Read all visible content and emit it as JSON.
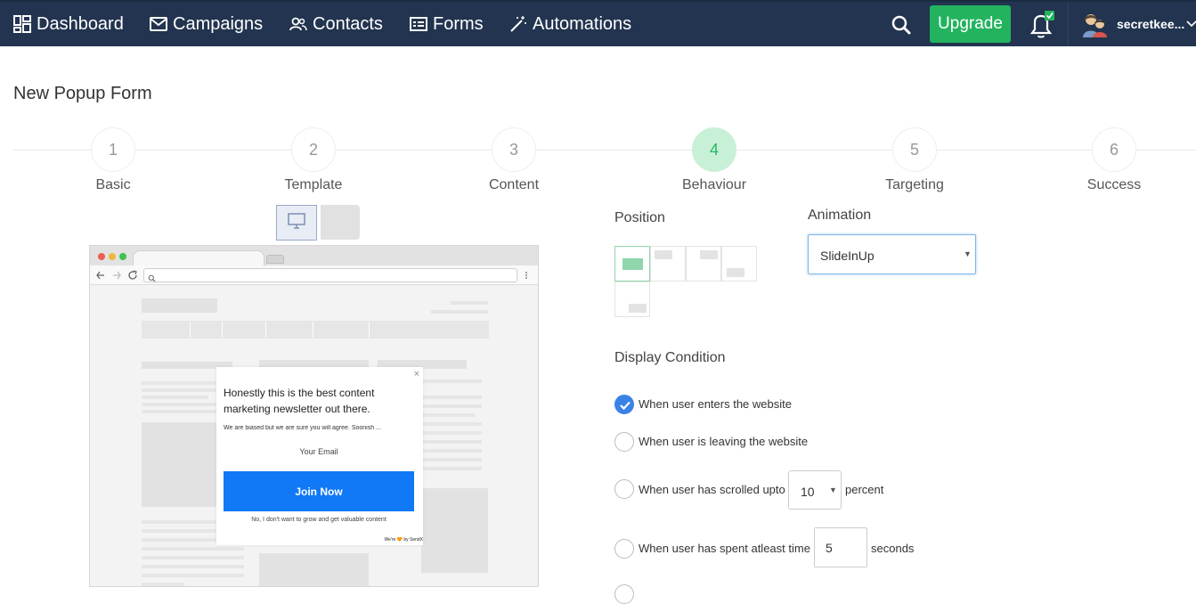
{
  "nav": {
    "items": [
      {
        "label": "Dashboard",
        "icon": "dashboard-icon"
      },
      {
        "label": "Campaigns",
        "icon": "envelope-icon"
      },
      {
        "label": "Contacts",
        "icon": "contacts-icon"
      },
      {
        "label": "Forms",
        "icon": "forms-icon"
      },
      {
        "label": "Automations",
        "icon": "magic-wand-icon"
      }
    ],
    "upgrade_label": "Upgrade",
    "username": "secretkee...",
    "bg_color": "#22344f",
    "upgrade_color": "#23b35f"
  },
  "page": {
    "title": "New Popup Form"
  },
  "steps": [
    {
      "number": "1",
      "label": "Basic"
    },
    {
      "number": "2",
      "label": "Template"
    },
    {
      "number": "3",
      "label": "Content"
    },
    {
      "number": "4",
      "label": "Behaviour",
      "active": true
    },
    {
      "number": "5",
      "label": "Targeting"
    },
    {
      "number": "6",
      "label": "Success"
    }
  ],
  "preview": {
    "popup": {
      "close": "×",
      "title": "Honestly this is the best content marketing newsletter out there.",
      "subtitle": "We are biased but we are sure you will agree. Soonish ...",
      "email_placeholder": "Your Email",
      "cta": "Join Now",
      "decline": "No, I don't want to grow and get valuable content",
      "credit": "We're 🧡 by SendX"
    }
  },
  "behaviour": {
    "position_label": "Position",
    "animation_label": "Animation",
    "animation_value": "SlideInUp",
    "display_condition_label": "Display Condition",
    "conditions": {
      "enter": "When user enters the website",
      "leave": "When user is leaving the website",
      "scroll_prefix": "When user has scrolled upto",
      "scroll_value": "10",
      "scroll_suffix": "percent",
      "time_prefix": "When user has spent atleast time",
      "time_value": "5",
      "time_suffix": "seconds"
    }
  }
}
